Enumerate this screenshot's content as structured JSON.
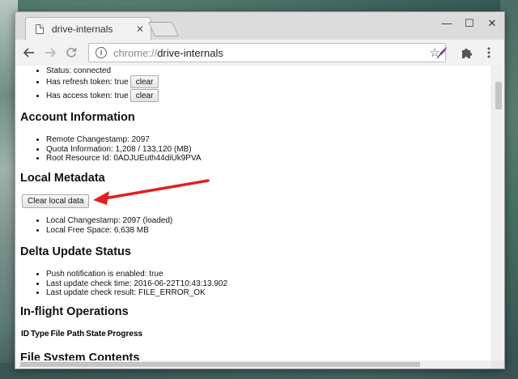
{
  "browser": {
    "tab_title": "drive-internals",
    "tab_close": "✕",
    "url_scheme": "chrome://",
    "url_host": "drive-internals",
    "window_controls": {
      "minimize": "—",
      "maximize": "☐",
      "close": "✕"
    },
    "icons": [
      "page-icon",
      "back-icon",
      "forward-icon",
      "reload-icon",
      "info-icon",
      "star-icon",
      "feather-extension-icon",
      "puzzle-extension-icon",
      "menu-icon"
    ]
  },
  "page": {
    "status_items": [
      {
        "text": "Status: connected",
        "button": ""
      },
      {
        "text": "Has refresh token: true",
        "button": "clear"
      },
      {
        "text": "Has access token: true",
        "button": "clear"
      }
    ],
    "account_information": {
      "heading": "Account Information",
      "items": [
        "Remote Changestamp: 2097",
        "Quota Information: 1,208 / 133,120 (MB)",
        "Root Resource Id: 0ADJUEuth44diUk9PVA"
      ]
    },
    "local_metadata": {
      "heading": "Local Metadata",
      "button": "Clear local data",
      "items": [
        "Local Changestamp: 2097 (loaded)",
        "Local Free Space: 6,638 MB"
      ]
    },
    "delta_update_status": {
      "heading": "Delta Update Status",
      "items": [
        "Push notification is enabled: true",
        "Last update check time: 2016-06-22T10:43:13.902",
        "Last update check result: FILE_ERROR_OK"
      ]
    },
    "in_flight_operations": {
      "heading": "In-flight Operations",
      "columns": [
        "ID",
        "Type",
        "File Path",
        "State",
        "Progress"
      ]
    },
    "file_system_contents": {
      "heading": "File System Contents"
    }
  },
  "annotation": {
    "arrow_color": "#e02020"
  }
}
